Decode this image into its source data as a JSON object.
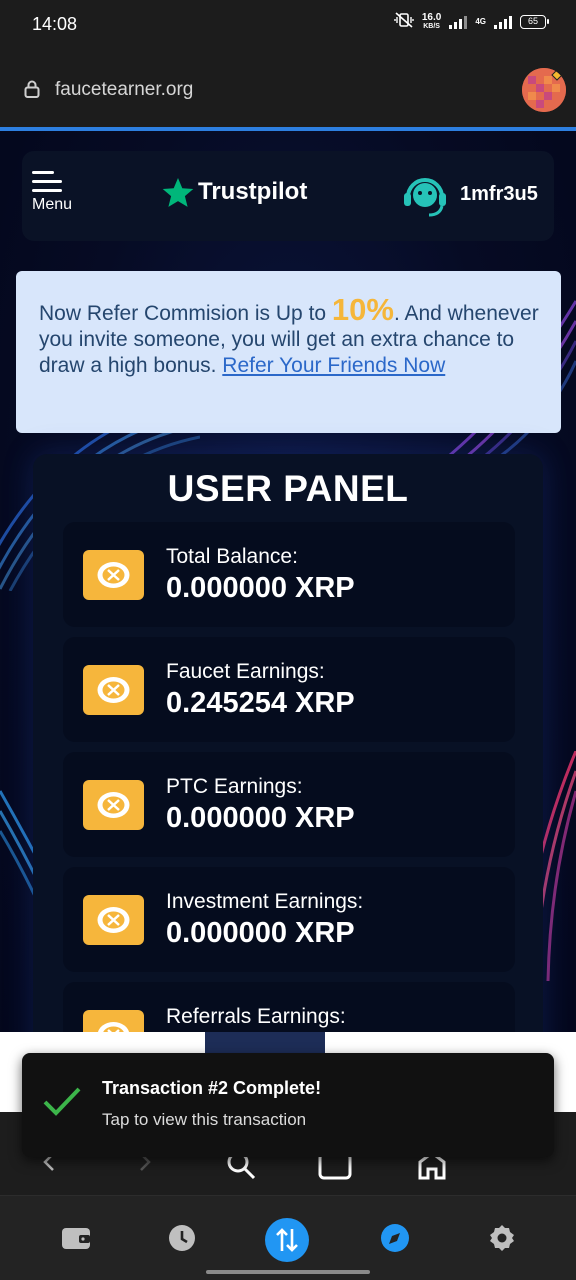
{
  "status_bar": {
    "time": "14:08",
    "net_speed": "16.0",
    "net_unit": "KB/S",
    "net_type": "4G",
    "battery": "65"
  },
  "browser": {
    "url": "faucetearner.org"
  },
  "site_nav": {
    "menu_label": "Menu",
    "trustpilot_label": "Trustpilot",
    "username": "1mfr3u5"
  },
  "notice": {
    "text_before": "Now Refer Commision is Up to ",
    "highlight": "10%",
    "text_after": ". And whenever you invite someone, you will get an extra chance to draw a high bonus. ",
    "link": "Refer Your Friends Now"
  },
  "panel": {
    "title": "USER PANEL",
    "cards": [
      {
        "label": "Total Balance:",
        "value": "0.000000 XRP"
      },
      {
        "label": "Faucet Earnings:",
        "value": "0.245254 XRP"
      },
      {
        "label": "PTC Earnings:",
        "value": "0.000000 XRP"
      },
      {
        "label": "Investment Earnings:",
        "value": "0.000000 XRP"
      },
      {
        "label": "Referrals Earnings:",
        "value": ""
      }
    ]
  },
  "toast": {
    "title": "Transaction #2 Complete!",
    "subtitle": "Tap to view this transaction"
  },
  "colors": {
    "accent": "#2196f3",
    "coin": "#f6b63c",
    "trustpilot_star": "#00b67a",
    "success": "#3cb54a"
  },
  "bottom_nav": [
    "wallet-icon",
    "history-icon",
    "transfer-icon",
    "browser-compass-icon",
    "settings-icon"
  ]
}
